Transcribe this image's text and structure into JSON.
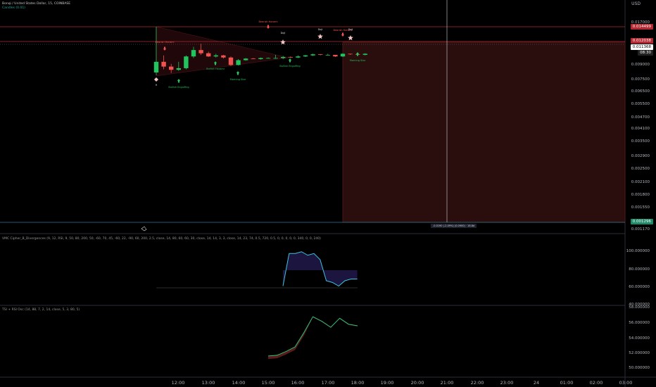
{
  "header": {
    "title": "Bonqi / United States Dollar, 15, COINBASE",
    "subtitle": "Candles (0.01)"
  },
  "price_axis": {
    "currency": "USD",
    "labels": [
      "0.017000",
      "0.014499",
      "0.012038",
      "0.011368",
      "08:30",
      "0.009000",
      "0.007500",
      "0.006500",
      "0.005500",
      "0.004700",
      "0.004100",
      "0.003500",
      "0.002900",
      "0.002500",
      "0.002100",
      "0.001800",
      "0.001550",
      "0.001296",
      "0.001170"
    ],
    "red_tag": "0.014499",
    "tag_mid": "0.012038",
    "tag_price": "0.011368",
    "tag_countdown": "08:30",
    "tag_green": "0.001296"
  },
  "panel2": {
    "title": "VMC Cipher_B_Divergences (9, 12, RSI, 9, 50, 80, 200, 50, -60, 70, 45, -60, 22, -90, 60, 200, 2.5, close, 14, 80, 60, 60, 30, close, 14, 14, 3, 3, close, 14, 23, 74, 0.5, 720, 0.5, 0, 0, 0, 0, 0, 340, 0, 0, 240)",
    "labels": [
      "100.000000",
      "80.000000",
      "60.000000",
      "40.000000"
    ]
  },
  "panel3": {
    "title": "TSI + RSI Osc (14, 88, 7, 2, 14, close, 5, 3, 80, 5)",
    "labels": [
      "58.000000",
      "56.000000",
      "54.000000",
      "52.000000",
      "50.000000"
    ]
  },
  "time_axis": [
    "12:00",
    "13:00",
    "14:00",
    "15:00",
    "16:00",
    "17:00",
    "18:00",
    "19:00",
    "20:00",
    "21:00",
    "22:00",
    "23:00",
    "24",
    "01:00",
    "02:00",
    "03:00"
  ],
  "crosshair_label": "-0.0190 (-2.09%)  (0.0900) · 18.8d",
  "pattern_labels": {
    "bullish_engulfing": "Bullish Engulfing",
    "bullish_harami": "Bullish Harami",
    "morning_star": "Morning Star",
    "doji": "Doji",
    "bearish_harami": "Bearish Harami",
    "h": "H"
  },
  "colors": {
    "bull": "#26a69a",
    "bull_bright": "#21c55d",
    "bear": "#ef5350",
    "grid": "#1c1f26",
    "red_line": "#b22833",
    "blue_line": "#2d7d9a"
  },
  "candles": [
    {
      "o": 0.0088,
      "h": 0.0175,
      "l": 0.0083,
      "c": 0.0108
    },
    {
      "o": 0.0108,
      "h": 0.012,
      "l": 0.0094,
      "c": 0.0099
    },
    {
      "o": 0.0099,
      "h": 0.0104,
      "l": 0.0087,
      "c": 0.0093
    },
    {
      "o": 0.0093,
      "h": 0.0108,
      "l": 0.0091,
      "c": 0.0096
    },
    {
      "o": 0.0096,
      "h": 0.012,
      "l": 0.0094,
      "c": 0.0118
    },
    {
      "o": 0.0118,
      "h": 0.0136,
      "l": 0.0115,
      "c": 0.013
    },
    {
      "o": 0.013,
      "h": 0.0142,
      "l": 0.0121,
      "c": 0.0124
    },
    {
      "o": 0.0124,
      "h": 0.0127,
      "l": 0.0117,
      "c": 0.0118
    },
    {
      "o": 0.0118,
      "h": 0.0123,
      "l": 0.0116,
      "c": 0.012
    },
    {
      "o": 0.012,
      "h": 0.0121,
      "l": 0.0114,
      "c": 0.0116
    },
    {
      "o": 0.0116,
      "h": 0.0118,
      "l": 0.01,
      "c": 0.0102
    },
    {
      "o": 0.0102,
      "h": 0.0113,
      "l": 0.0101,
      "c": 0.0111
    },
    {
      "o": 0.0111,
      "h": 0.0115,
      "l": 0.011,
      "c": 0.0114
    },
    {
      "o": 0.0114,
      "h": 0.0115,
      "l": 0.0113,
      "c": 0.0113
    },
    {
      "o": 0.0113,
      "h": 0.0116,
      "l": 0.0112,
      "c": 0.0115
    },
    {
      "o": 0.0115,
      "h": 0.0116,
      "l": 0.0114,
      "c": 0.0115
    },
    {
      "o": 0.0115,
      "h": 0.0121,
      "l": 0.0114,
      "c": 0.0115
    },
    {
      "o": 0.0115,
      "h": 0.0119,
      "l": 0.0113,
      "c": 0.0117
    },
    {
      "o": 0.0117,
      "h": 0.0118,
      "l": 0.0115,
      "c": 0.0116
    },
    {
      "o": 0.0116,
      "h": 0.012,
      "l": 0.0115,
      "c": 0.0118
    },
    {
      "o": 0.0118,
      "h": 0.0121,
      "l": 0.0117,
      "c": 0.012
    },
    {
      "o": 0.012,
      "h": 0.0123,
      "l": 0.0119,
      "c": 0.0122
    },
    {
      "o": 0.0122,
      "h": 0.0122,
      "l": 0.012,
      "c": 0.0121
    },
    {
      "o": 0.0121,
      "h": 0.0123,
      "l": 0.012,
      "c": 0.0121
    },
    {
      "o": 0.0121,
      "h": 0.0121,
      "l": 0.0117,
      "c": 0.0118
    },
    {
      "o": 0.0118,
      "h": 0.0124,
      "l": 0.0117,
      "c": 0.0123
    },
    {
      "o": 0.0123,
      "h": 0.0123,
      "l": 0.0121,
      "c": 0.0122
    },
    {
      "o": 0.0122,
      "h": 0.0124,
      "l": 0.012,
      "c": 0.0121
    },
    {
      "o": 0.0121,
      "h": 0.0124,
      "l": 0.012,
      "c": 0.0123
    }
  ],
  "vmc_series": [
    62,
    99,
    99,
    101,
    97,
    99,
    92,
    68,
    66,
    62,
    68,
    70,
    70
  ],
  "tsi_series": [
    51.4,
    51.5,
    52.0,
    52.6,
    54.5,
    56.6,
    56.0,
    55.2,
    56.4,
    55.6,
    55.4
  ]
}
